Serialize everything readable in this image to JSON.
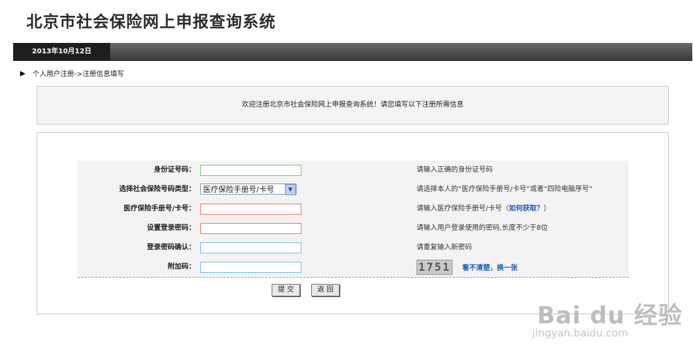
{
  "header": {
    "title": "北京市社会保险网上申报查询系统"
  },
  "datebar": {
    "date": "2013年10月12日"
  },
  "breadcrumb": {
    "arrow": "▶",
    "text": "个人用户注册->注册信息填写"
  },
  "welcome": {
    "text": "欢迎注册北京市社会保险网上申报查询系统！请您填写以下注册所需信息"
  },
  "form": {
    "id_label": "身份证号码：",
    "id_hint": "请输入正确的身份证号码",
    "type_label": "选择社会保险号码类型：",
    "type_value": "医疗保险手册号/卡号",
    "type_hint": "请选择本人的“医疗保险手册号/卡号”或者“四险电脑序号”",
    "card_label": "医疗保险手册号/卡号：",
    "card_hint": "请输入医疗保险手册号/卡号（",
    "card_hint_link": "如何获取？",
    "card_hint_end": "）",
    "pwd_label": "设置登录密码：",
    "pwd_hint": "请输入用户登录使用的密码,长度不少于8位",
    "pwd2_label": "登录密码确认：",
    "pwd2_hint": "请重复输入新密码",
    "code_label": "附加码：",
    "captcha": "1751",
    "refresh": "看不清楚，换一张",
    "submit": "提 交",
    "back": "返 回"
  },
  "watermark": {
    "brand": "Bai du 经验",
    "url": "jingyan.baidu.com"
  }
}
